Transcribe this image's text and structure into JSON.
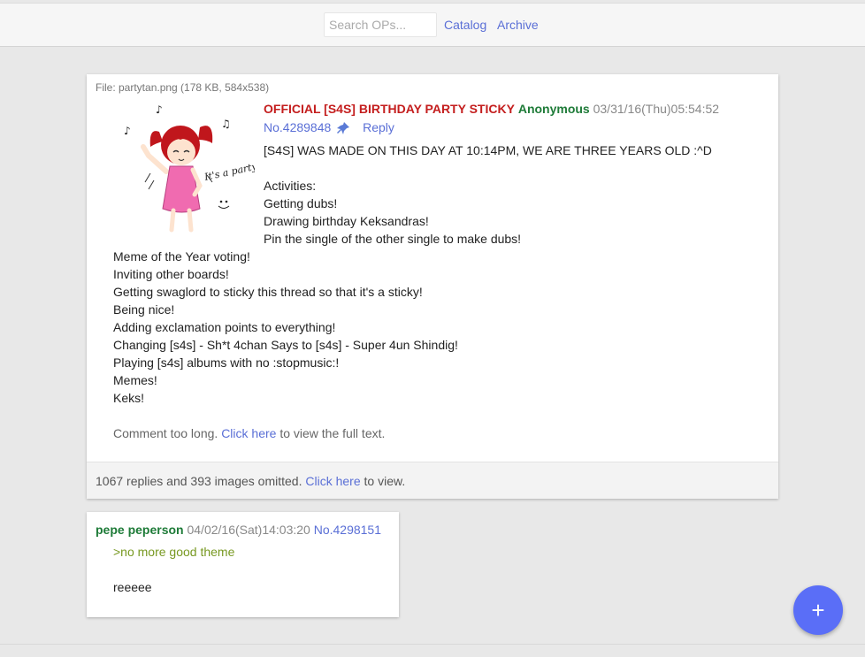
{
  "header": {
    "search_placeholder": "Search OPs...",
    "catalog_label": "Catalog",
    "archive_label": "Archive"
  },
  "op": {
    "file_info": "File: partytan.png (178 KB, 584x538)",
    "image_text": "It's a party",
    "subject": "OFFICIAL [S4S] BIRTHDAY PARTY STICKY",
    "name": "Anonymous",
    "date": "03/31/16(Thu)05:54:52",
    "post_number": "No.4289848",
    "reply_label": "Reply",
    "body_lines": [
      "[S4S] WAS MADE ON THIS DAY AT 10:14PM, WE ARE THREE YEARS OLD :^D",
      "",
      "Activities:",
      "Getting dubs!",
      "Drawing birthday Keksandras!",
      "Pin the single of the other single to make dubs!",
      "Meme of the Year voting!",
      "Inviting other boards!",
      "Getting swaglord to sticky this thread so that it's a sticky!",
      "Being nice!",
      "Adding exclamation points to everything!",
      "Changing [s4s] - Sh*t 4chan Says to [s4s] - Super 4un Shindig!",
      "Playing [s4s] albums with no :stopmusic:!",
      "Memes!",
      "Keks!"
    ],
    "too_long_prefix": "Comment too long.",
    "too_long_link": "Click here",
    "too_long_suffix": "to view the full text.",
    "omitted_text": "1067 replies and 393 images omitted.",
    "omitted_link": "Click here",
    "omitted_suffix": "to view."
  },
  "reply": {
    "name": "pepe peperson",
    "date": "04/02/16(Sat)14:03:20",
    "post_number": "No.4298151",
    "greentext": ">no more good theme",
    "body": "reeeee"
  },
  "fab": {
    "label": "+"
  },
  "colors": {
    "accent": "#5a6fd6",
    "subject": "#c41e1e",
    "name": "#1e7b38",
    "greentext": "#789922",
    "fab": "#5a6ef7"
  }
}
